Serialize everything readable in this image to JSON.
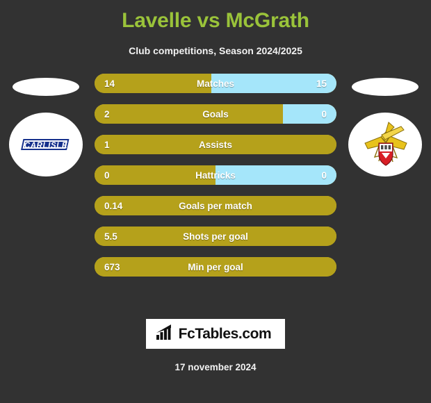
{
  "header": {
    "title": "Lavelle vs McGrath",
    "subtitle": "Club competitions, Season 2024/2025",
    "title_color": "#9ac33a"
  },
  "teams": {
    "home": {
      "badge_name": "carlisle-united-badge",
      "badge_text": "CARLISLE"
    },
    "away": {
      "badge_name": "doncaster-rovers-badge"
    }
  },
  "colors": {
    "background": "#323232",
    "home_bar": "#b5a11b",
    "away_bar": "#a5e6fa",
    "text": "#ffffff"
  },
  "chart_data": {
    "type": "bar",
    "title": "Lavelle vs McGrath",
    "subtitle": "Club competitions, Season 2024/2025",
    "categories": [
      "Matches",
      "Goals",
      "Assists",
      "Hattricks",
      "Goals per match",
      "Shots per goal",
      "Min per goal"
    ],
    "series": [
      {
        "name": "Lavelle",
        "values": [
          "14",
          "2",
          "1",
          "0",
          "0.14",
          "5.5",
          "673"
        ]
      },
      {
        "name": "McGrath",
        "values": [
          "15",
          "0",
          "",
          "0",
          "",
          "",
          ""
        ]
      }
    ],
    "rows": [
      {
        "label": "Matches",
        "home": "14",
        "away": "15",
        "home_pct": 48.3,
        "has_away": true
      },
      {
        "label": "Goals",
        "home": "2",
        "away": "0",
        "home_pct": 78.0,
        "has_away": true
      },
      {
        "label": "Assists",
        "home": "1",
        "away": "",
        "home_pct": 100,
        "has_away": false
      },
      {
        "label": "Hattricks",
        "home": "0",
        "away": "0",
        "home_pct": 50.0,
        "has_away": true
      },
      {
        "label": "Goals per match",
        "home": "0.14",
        "away": "",
        "home_pct": 100,
        "has_away": false
      },
      {
        "label": "Shots per goal",
        "home": "5.5",
        "away": "",
        "home_pct": 100,
        "has_away": false
      },
      {
        "label": "Min per goal",
        "home": "673",
        "away": "",
        "home_pct": 100,
        "has_away": false
      }
    ]
  },
  "footer": {
    "logo_text": "FcTables.com",
    "date": "17 november 2024"
  }
}
